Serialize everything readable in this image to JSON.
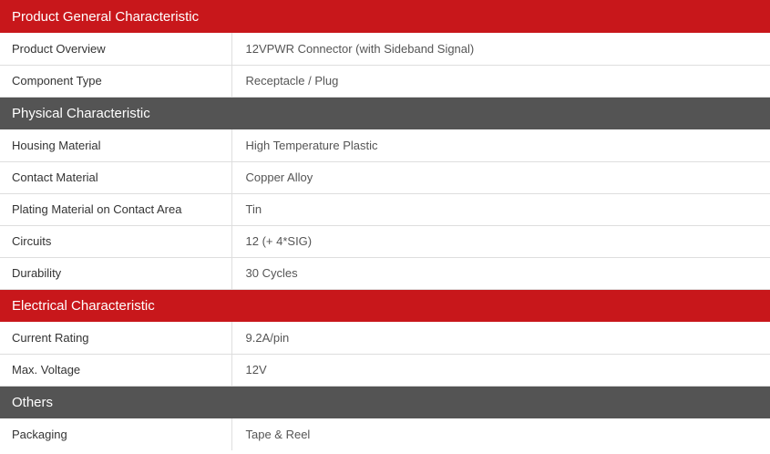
{
  "sections": [
    {
      "title": "Product General Characteristic",
      "rows": [
        {
          "label": "Product Overview",
          "value": "12VPWR Connector (with Sideband Signal)"
        },
        {
          "label": "Component Type",
          "value": "Receptacle / Plug"
        }
      ]
    },
    {
      "title": "Physical Characteristic",
      "rows": [
        {
          "label": "Housing Material",
          "value": "High Temperature Plastic"
        },
        {
          "label": "Contact Material",
          "value": "Copper Alloy"
        },
        {
          "label": "Plating Material on Contact Area",
          "value": "Tin"
        },
        {
          "label": "Circuits",
          "value": "12 (+ 4*SIG)"
        },
        {
          "label": "Durability",
          "value": "30 Cycles"
        }
      ]
    },
    {
      "title": "Electrical Characteristic",
      "rows": [
        {
          "label": "Current Rating",
          "value": "9.2A/pin"
        },
        {
          "label": "Max. Voltage",
          "value": "12V"
        }
      ]
    },
    {
      "title": "Others",
      "rows": [
        {
          "label": "Packaging",
          "value": "Tape & Reel"
        }
      ]
    }
  ],
  "colors": {
    "red_header": "#c8171b",
    "gray_header": "#545454"
  }
}
